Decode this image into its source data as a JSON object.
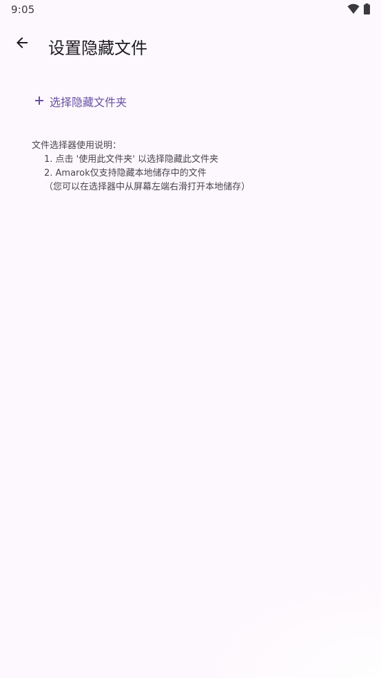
{
  "status_bar": {
    "time": "9:05",
    "icons": [
      "wifi-icon",
      "battery-icon"
    ]
  },
  "top_bar": {
    "back_icon": "arrow-back-icon",
    "title": "设置隐藏文件"
  },
  "select_button": {
    "icon": "plus-icon",
    "label": "选择隐藏文件夹"
  },
  "instructions": {
    "heading": "文件选择器使用说明：",
    "step1": "1. 点击 '使用此文件夹' 以选择隐藏此文件夹",
    "step2": "2. Amarok仅支持隐藏本地储存中的文件",
    "note": "（您可以在选择器中从屏幕左端右滑打开本地储存）"
  },
  "colors": {
    "background": "#fdf8fd",
    "accent": "#6750a4",
    "text_primary": "#1c1b1f",
    "text_secondary": "#49454f"
  }
}
